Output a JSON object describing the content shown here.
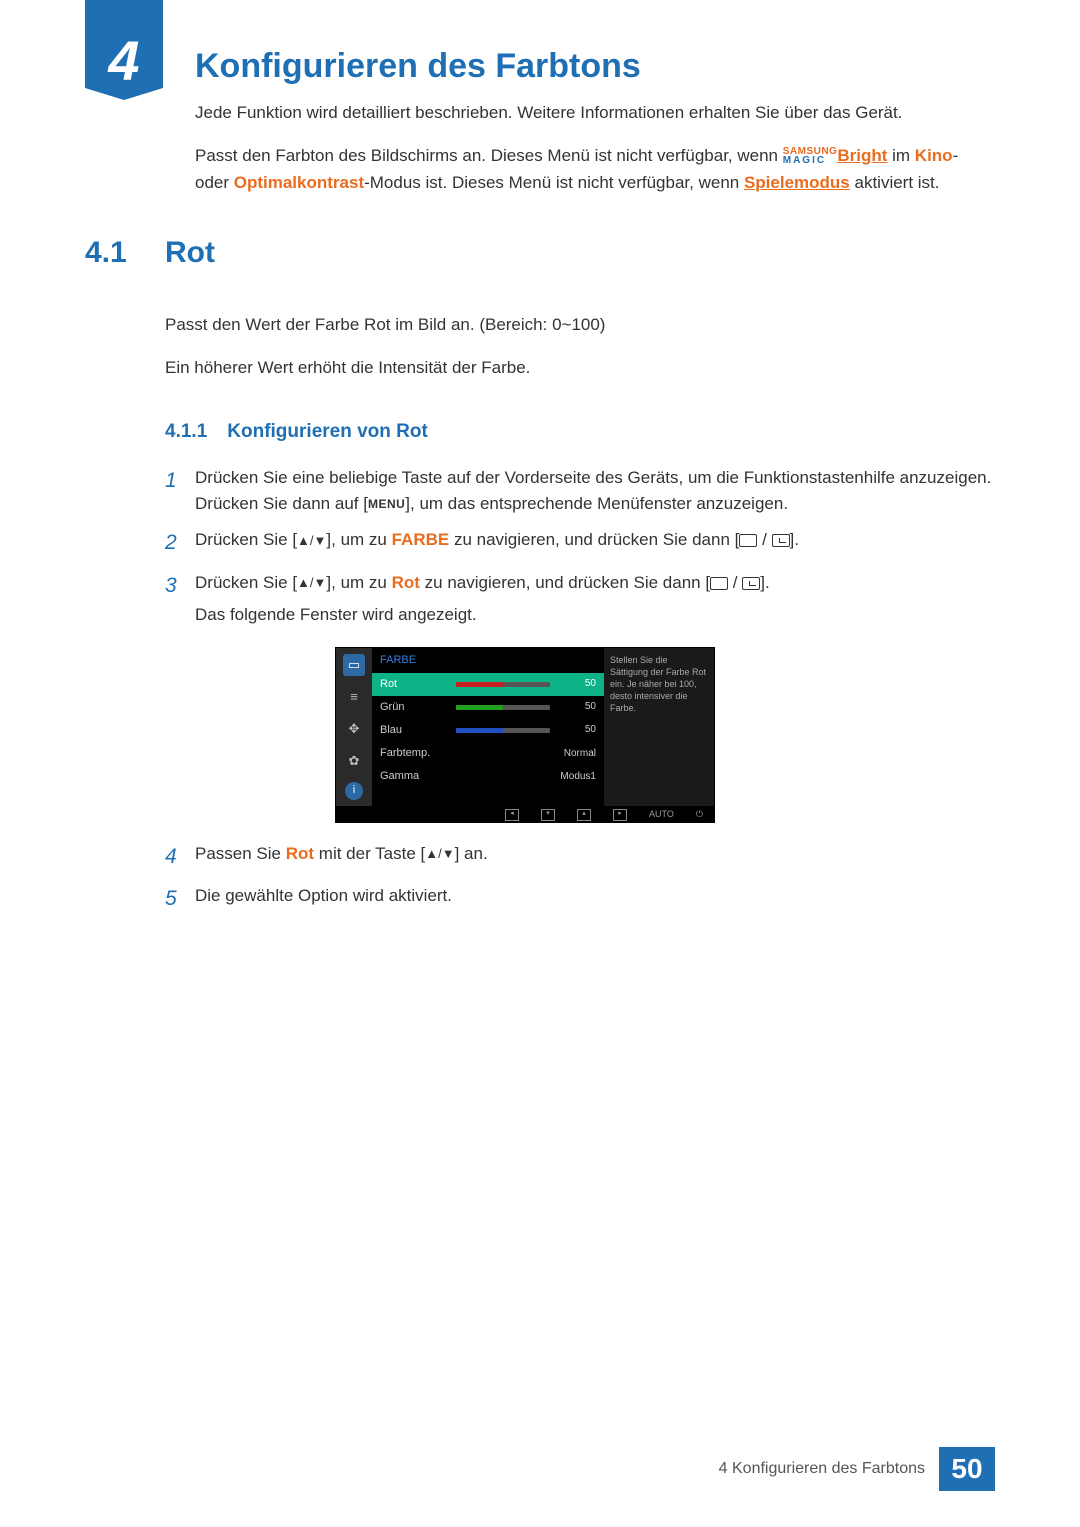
{
  "chapter": {
    "number": "4",
    "title": "Konfigurieren des Farbtons"
  },
  "intro": {
    "p1": "Jede Funktion wird detailliert beschrieben. Weitere Informationen erhalten Sie über das Gerät.",
    "p2a": "Passt den Farbton des Bildschirms an. Dieses Menü ist nicht verfügbar, wenn ",
    "magic_top": "SAMSUNG",
    "magic_bot": "MAGIC",
    "bright": "Bright",
    "p2b": " im ",
    "kino": "Kino",
    "p2c": "- oder ",
    "optimal": "Optimalkontrast",
    "p2d": "-Modus ist. Dieses Menü ist nicht verfügbar, wenn ",
    "spiel": "Spielemodus",
    "p2e": " aktiviert ist."
  },
  "section": {
    "num": "4.1",
    "title": "Rot",
    "p1": "Passt den Wert der Farbe Rot im Bild an. (Bereich: 0~100)",
    "p2": "Ein höherer Wert erhöht die Intensität der Farbe."
  },
  "subsection": {
    "num": "4.1.1",
    "title": "Konfigurieren von Rot"
  },
  "steps": {
    "s1a": "Drücken Sie eine beliebige Taste auf der Vorderseite des Geräts, um die Funktionstastenhilfe anzuzeigen. Drücken Sie dann auf [",
    "menu": "MENU",
    "s1b": "], um das entsprechende Menüfenster anzuzeigen.",
    "s2a": "Drücken Sie [",
    "s2b": "], um zu ",
    "farbe": "FARBE",
    "s2c": " zu navigieren, und drücken Sie dann [",
    "s2d": "].",
    "s3a": "Drücken Sie [",
    "s3b": "], um zu ",
    "rot": "Rot",
    "s3c": " zu navigieren, und drücken Sie dann [",
    "s3d": "].",
    "s3e": "Das folgende Fenster wird angezeigt.",
    "s4a": "Passen Sie ",
    "s4rot": "Rot",
    "s4b": " mit der Taste [",
    "s4c": "] an.",
    "s5": "Die gewählte Option wird aktiviert."
  },
  "osd": {
    "title": "FARBE",
    "rows": [
      {
        "label": "Rot",
        "value": "50",
        "fill": 50,
        "color": "#c62020",
        "sel": true
      },
      {
        "label": "Grün",
        "value": "50",
        "fill": 50,
        "color": "#20a020"
      },
      {
        "label": "Blau",
        "value": "50",
        "fill": 50,
        "color": "#2050c0"
      },
      {
        "label": "Farbtemp.",
        "value": "Normal"
      },
      {
        "label": "Gamma",
        "value": "Modus1"
      }
    ],
    "help": "Stellen Sie die Sättigung der Farbe Rot ein. Je näher bei 100, desto intensiver die Farbe.",
    "auto": "AUTO"
  },
  "footer": {
    "text": "4 Konfigurieren des Farbtons",
    "page": "50"
  }
}
